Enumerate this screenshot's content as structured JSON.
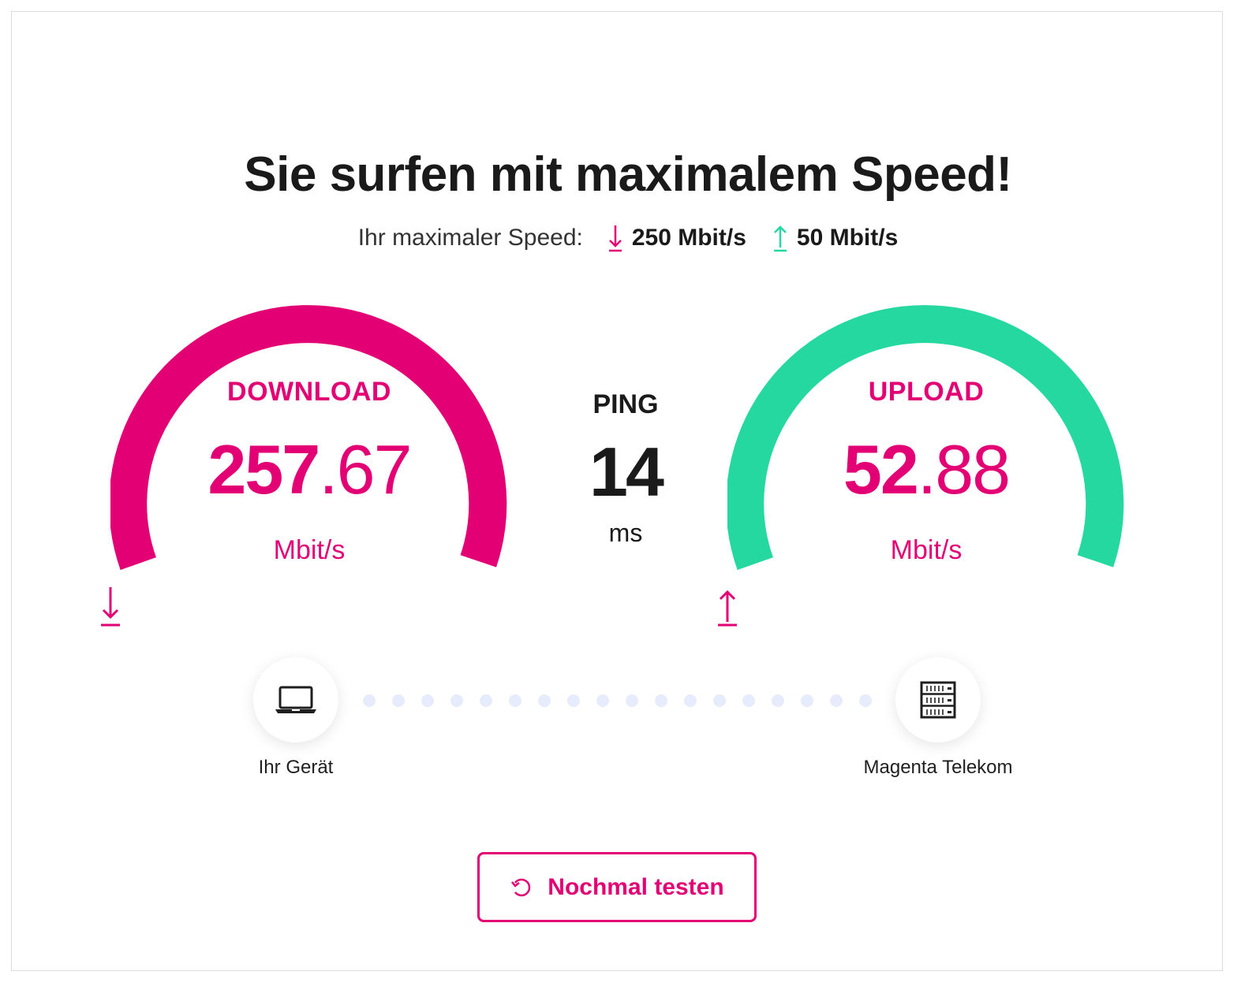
{
  "headline": "Sie surfen mit maximalem Speed!",
  "max_speed": {
    "label": "Ihr maximaler Speed:",
    "download": "250 Mbit/s",
    "upload": "50 Mbit/s"
  },
  "download": {
    "title": "DOWNLOAD",
    "value_int": "257",
    "value_dec": ".67",
    "unit": "Mbit/s",
    "color": "#e20074"
  },
  "ping": {
    "title": "PING",
    "value": "14",
    "unit": "ms"
  },
  "upload": {
    "title": "UPLOAD",
    "value_int": "52",
    "value_dec": ".88",
    "unit": "Mbit/s",
    "color": "#24d8a0"
  },
  "connection": {
    "device_label": "Ihr Gerät",
    "server_label": "Magenta Telekom",
    "device_icon": "laptop-icon",
    "server_icon": "server-icon"
  },
  "retest_button": {
    "label": "Nochmal testen",
    "icon": "refresh-icon"
  },
  "colors": {
    "brand": "#e20074",
    "upload_accent": "#24d8a0",
    "dots": "#e6ecfb"
  }
}
